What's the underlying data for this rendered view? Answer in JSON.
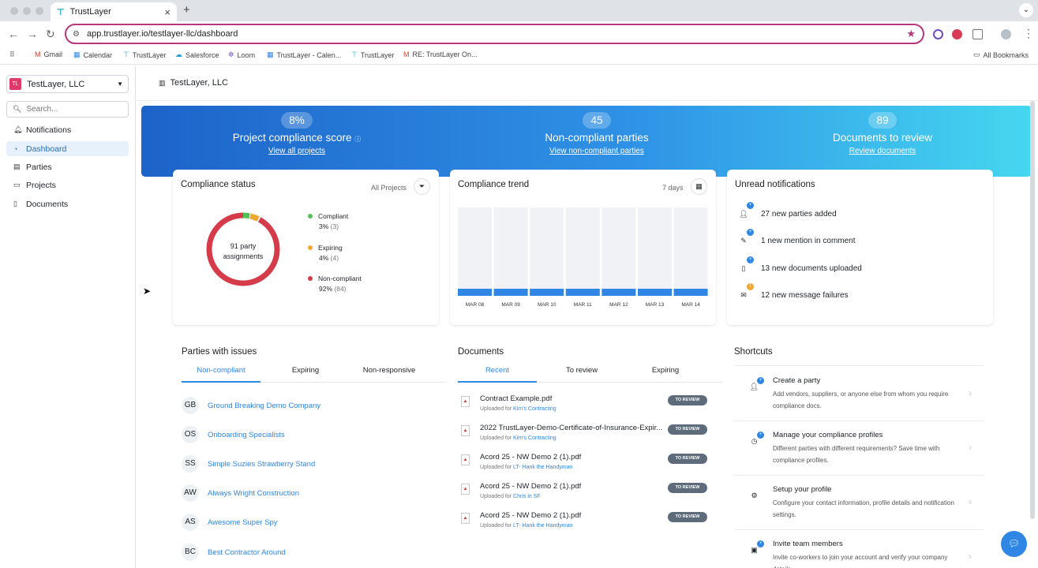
{
  "browser": {
    "tab_title": "TrustLayer",
    "url": "app.trustlayer.io/testlayer-llc/dashboard",
    "bookmarks": [
      "Gmail",
      "Calendar",
      "TrustLayer",
      "Salesforce",
      "Loom",
      "TrustLayer - Calen...",
      "TrustLayer",
      "RE: TrustLayer On..."
    ],
    "all_bookmarks": "All Bookmarks"
  },
  "sidebar": {
    "org_badge": "TL",
    "org_name": "TestLayer, LLC",
    "search_placeholder": "Search...",
    "items": [
      {
        "label": "Notifications",
        "icon": "bell-icon"
      },
      {
        "label": "Dashboard",
        "icon": "dashboard-icon"
      },
      {
        "label": "Parties",
        "icon": "parties-icon"
      },
      {
        "label": "Projects",
        "icon": "folder-icon"
      },
      {
        "label": "Documents",
        "icon": "document-icon"
      }
    ]
  },
  "header": {
    "breadcrumb": "TestLayer, LLC"
  },
  "hero": {
    "stats": [
      {
        "value": "8%",
        "label": "Project compliance score",
        "link": "View all projects"
      },
      {
        "value": "45",
        "label": "Non-compliant parties",
        "link": "View non-compliant parties"
      },
      {
        "value": "89",
        "label": "Documents to review",
        "link": "Review documents"
      }
    ]
  },
  "compliance_status": {
    "title": "Compliance status",
    "filter_label": "All Projects",
    "donut_label": "91 party assignments",
    "legend": [
      {
        "name": "Compliant",
        "pct": "3%",
        "count": "(3)",
        "color": "#52c052"
      },
      {
        "name": "Expiring",
        "pct": "4%",
        "count": "(4)",
        "color": "#f0a830"
      },
      {
        "name": "Non-compliant",
        "pct": "92%",
        "count": "(84)",
        "color": "#d63b4a"
      }
    ]
  },
  "compliance_trend": {
    "title": "Compliance trend",
    "range": "7 days"
  },
  "chart_data": {
    "type": "bar",
    "categories": [
      "MAR 08",
      "MAR 09",
      "MAR 10",
      "MAR 11",
      "MAR 12",
      "MAR 13",
      "MAR 14"
    ],
    "values": [
      8,
      8,
      8,
      8,
      8,
      8,
      8
    ],
    "ylim": [
      0,
      100
    ],
    "title": "Compliance trend",
    "colors": {
      "bar": "#2f86e5",
      "track": "#f0f2f5"
    }
  },
  "notifications": {
    "title": "Unread notifications",
    "items": [
      {
        "text": "27 new parties added",
        "icon": "user-icon",
        "badge": "+"
      },
      {
        "text": "1 new mention in comment",
        "icon": "mention-icon",
        "badge": "+"
      },
      {
        "text": "13 new documents uploaded",
        "icon": "file-icon",
        "badge": "+"
      },
      {
        "text": "12 new message failures",
        "icon": "mail-icon",
        "badge": "!"
      }
    ]
  },
  "parties": {
    "title": "Parties with issues",
    "tabs": [
      "Non-compliant",
      "Expiring",
      "Non-responsive"
    ],
    "items": [
      {
        "initials": "GB",
        "name": "Ground Breaking Demo Company"
      },
      {
        "initials": "OS",
        "name": "Onboarding Specialists"
      },
      {
        "initials": "SS",
        "name": "Simple Suzies Strawberry Stand"
      },
      {
        "initials": "AW",
        "name": "Always Wright Construction"
      },
      {
        "initials": "AS",
        "name": "Awesome Super Spy"
      },
      {
        "initials": "BC",
        "name": "Best Contractor Around"
      }
    ]
  },
  "documents": {
    "title": "Documents",
    "tabs": [
      "Recent",
      "To review",
      "Expiring"
    ],
    "uploaded_prefix": "Uploaded for",
    "status": "TO REVIEW",
    "items": [
      {
        "name": "Contract Example.pdf",
        "for": "Kim's Contracting"
      },
      {
        "name": "2022 TrustLayer-Demo-Certificate-of-Insurance-Expir...",
        "for": "Kim's Contracting"
      },
      {
        "name": "Acord 25 - NW Demo 2 (1).pdf",
        "for": "LT- Hank the Handyman"
      },
      {
        "name": "Acord 25 - NW Demo 2 (1).pdf",
        "for": "Chris in SF"
      },
      {
        "name": "Acord 25 - NW Demo 2 (1).pdf",
        "for": "LT- Hank the Handyman"
      }
    ]
  },
  "shortcuts": {
    "title": "Shortcuts",
    "items": [
      {
        "title": "Create a party",
        "desc": "Add vendors, suppliers, or anyone else from whom you require compliance docs.",
        "icon": "add-party-icon"
      },
      {
        "title": "Manage your compliance profiles",
        "desc": "Different parties with different requirements? Save time with compliance profiles.",
        "icon": "compliance-profile-icon"
      },
      {
        "title": "Setup your profile",
        "desc": "Configure your contact information, profile details and notification settings.",
        "icon": "profile-settings-icon"
      },
      {
        "title": "Invite team members",
        "desc": "Invite co-workers to join your account and verify your company details.",
        "icon": "invite-icon"
      }
    ]
  }
}
